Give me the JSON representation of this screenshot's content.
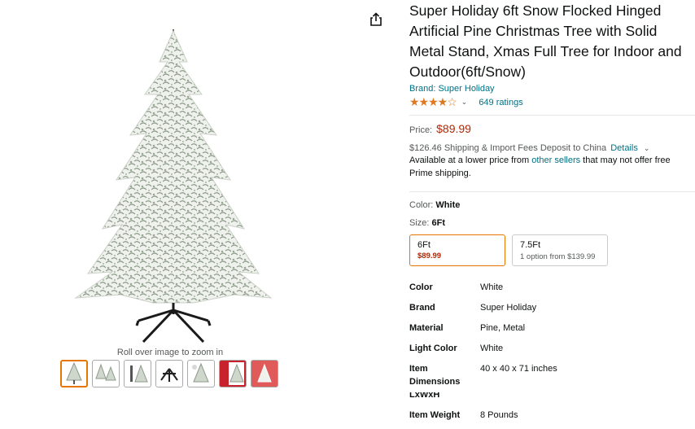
{
  "product": {
    "title": "Super Holiday 6ft Snow Flocked Hinged Artificial Pine Christmas Tree with Solid Metal Stand, Xmas Full Tree for Indoor and Outdoor(6ft/Snow)",
    "brand_link": "Brand: Super Holiday",
    "rating_stars": 4.2,
    "ratings_count": "649 ratings",
    "price_label": "Price:",
    "price": "$89.99",
    "shipping_text": "$126.46 Shipping & Import Fees Deposit to China",
    "shipping_details": "Details",
    "avail_pre": "Available at a lower price from ",
    "avail_link": "other sellers",
    "avail_post": " that may not offer free Prime shipping.",
    "color_label": "Color: ",
    "color_value": "White",
    "size_label": "Size: ",
    "size_value": "6Ft",
    "size_options": [
      {
        "name": "6Ft",
        "price": "$89.99"
      },
      {
        "name": "7.5Ft",
        "sub": "1 option from $139.99"
      }
    ]
  },
  "specs": [
    {
      "key": "Color",
      "value": "White"
    },
    {
      "key": "Brand",
      "value": "Super Holiday"
    },
    {
      "key": "Material",
      "value": "Pine, Metal"
    },
    {
      "key": "Light Color",
      "value": "White"
    },
    {
      "key": "Item Dimensions LxWxH",
      "value": "40 x 40 x 71 inches"
    },
    {
      "key": "Item Weight",
      "value": "8 Pounds"
    }
  ],
  "gallery": {
    "zoom_hint": "Roll over image to zoom in",
    "thumb_count": 7
  },
  "colors": {
    "link": "#007185",
    "price": "#b12704",
    "star": "#de7921",
    "selected_border": "#e77600"
  }
}
